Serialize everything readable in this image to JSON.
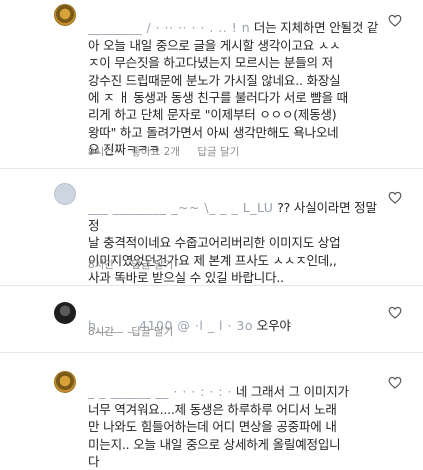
{
  "comments": [
    {
      "username": "________ / · ·· ·· · · . .. ! n",
      "text": "더는 지체하면 안될것 같\n아 오늘 내일 중으로 글을 게시할 생각이고요 ㅅㅅ\nㅈ이 무슨짓을 하고다녔는지 모르시는 분들의 저\n강수진 드립때문에 분노가 가시질 않네요.. 화장실\n에 ㅈ ㅐ 동생과 동생 친구를 불러다가 서로 뺨을 때\n리게 하고 단체 문자로 \"이제부터 ㅇㅇㅇ(제동생)\n왕따\" 하고 돌려가면서 아씨 생각만해도 욕나오네\n요 진짜ㅋㅋㅋ",
      "time": "9시간",
      "likes": "좋아요 2개",
      "reply": "답글 달기"
    },
    {
      "username": "___ ________ _~~ \\_ _ _ L_LU",
      "text": "?? 사실이라면 정말 정\n날 충격적이네요 수줍고어리버리한 이미지도 상업\n이미지였었던건가요 제 본계 프사도 ㅅㅅㅈ인데,,\n사과 똑바로 받으실 수 있길 바랍니다..",
      "time": "8시간",
      "reply": "답글 달기"
    },
    {
      "username": "h____ _ 4100 @ ·l _ l · 3o",
      "text": "오우야",
      "time": "8시간",
      "reply": "답글 달기"
    },
    {
      "username": "_ _ ______ __  · · · : · : ·",
      "text": "네 그래서 그 이미지가\n너무 역겨워요....제 동생은 하루하루 어디서 노래\n만 나와도 힘들어하는데 어디 면상을 공중파에 내\n미는지.. 오늘 내일 중으로 상세하게 올릴예정입니\n다",
      "time": "",
      "reply": ""
    }
  ]
}
